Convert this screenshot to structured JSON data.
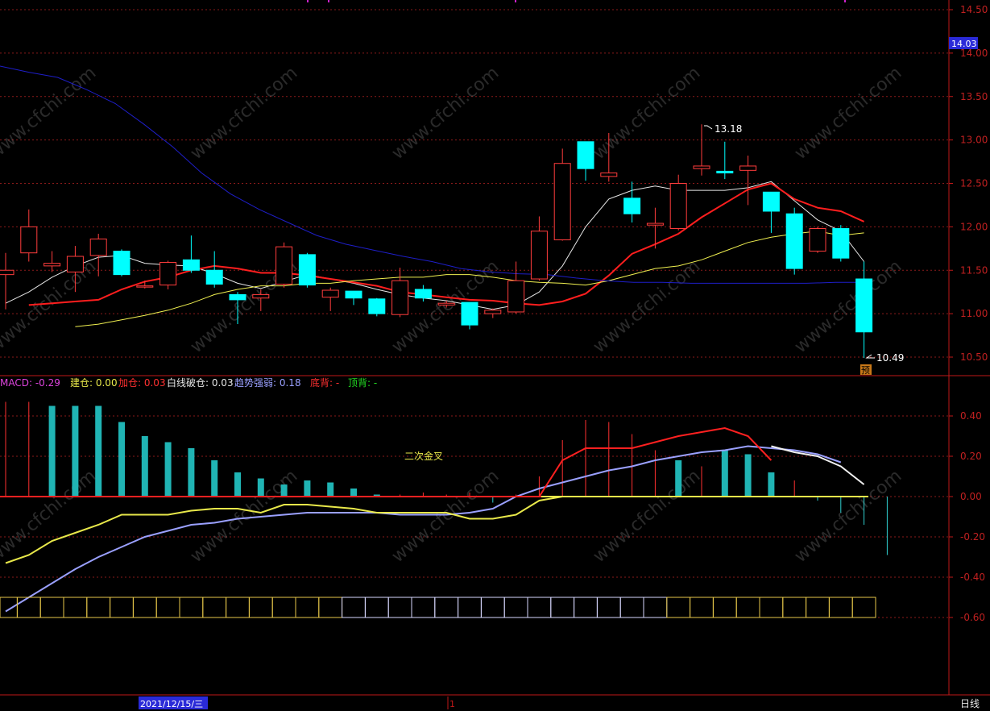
{
  "chart_data": [
    {
      "type": "candlestick",
      "title": "",
      "period_label": "日线",
      "date_label": "2021/12/15/三",
      "cursor_label": "1",
      "ylim": [
        10.25,
        14.6
      ],
      "yticks": [
        "14.50",
        "14.00",
        "13.50",
        "13.00",
        "12.50",
        "12.00",
        "11.50",
        "11.00",
        "10.50"
      ],
      "current_price_tag": "14.03",
      "high_annotation": "13.18",
      "low_annotation": "10.49",
      "forecast_badge": "预",
      "candles": [
        {
          "o": 11.45,
          "h": 11.7,
          "l": 11.05,
          "c": 11.5
        },
        {
          "o": 11.7,
          "h": 12.2,
          "l": 11.6,
          "c": 12.0
        },
        {
          "o": 11.55,
          "h": 11.72,
          "l": 11.48,
          "c": 11.58
        },
        {
          "o": 11.48,
          "h": 11.78,
          "l": 11.25,
          "c": 11.66
        },
        {
          "o": 11.67,
          "h": 11.92,
          "l": 11.43,
          "c": 11.86
        },
        {
          "o": 11.72,
          "h": 11.74,
          "l": 11.43,
          "c": 11.45
        },
        {
          "o": 11.31,
          "h": 11.38,
          "l": 11.29,
          "c": 11.32
        },
        {
          "o": 11.33,
          "h": 11.61,
          "l": 11.28,
          "c": 11.59
        },
        {
          "o": 11.62,
          "h": 11.9,
          "l": 11.47,
          "c": 11.5
        },
        {
          "o": 11.5,
          "h": 11.72,
          "l": 11.3,
          "c": 11.34
        },
        {
          "o": 11.22,
          "h": 11.25,
          "l": 10.88,
          "c": 11.16
        },
        {
          "o": 11.18,
          "h": 11.28,
          "l": 11.03,
          "c": 11.22
        },
        {
          "o": 11.34,
          "h": 11.82,
          "l": 11.3,
          "c": 11.77
        },
        {
          "o": 11.68,
          "h": 11.7,
          "l": 11.3,
          "c": 11.33
        },
        {
          "o": 11.19,
          "h": 11.3,
          "l": 11.03,
          "c": 11.27
        },
        {
          "o": 11.26,
          "h": 11.26,
          "l": 11.1,
          "c": 11.18
        },
        {
          "o": 11.17,
          "h": 11.18,
          "l": 10.97,
          "c": 11.0
        },
        {
          "o": 10.99,
          "h": 11.53,
          "l": 10.96,
          "c": 11.38
        },
        {
          "o": 11.28,
          "h": 11.33,
          "l": 11.14,
          "c": 11.18
        },
        {
          "o": 11.1,
          "h": 11.15,
          "l": 11.07,
          "c": 11.12
        },
        {
          "o": 11.13,
          "h": 11.13,
          "l": 10.82,
          "c": 10.87
        },
        {
          "o": 11.0,
          "h": 11.06,
          "l": 10.95,
          "c": 11.04
        },
        {
          "o": 11.02,
          "h": 11.6,
          "l": 11.0,
          "c": 11.38
        },
        {
          "o": 11.4,
          "h": 12.12,
          "l": 11.38,
          "c": 11.95
        },
        {
          "o": 11.85,
          "h": 12.9,
          "l": 11.84,
          "c": 12.73
        },
        {
          "o": 12.98,
          "h": 12.98,
          "l": 12.53,
          "c": 12.67
        },
        {
          "o": 12.58,
          "h": 13.08,
          "l": 12.52,
          "c": 12.62
        },
        {
          "o": 12.33,
          "h": 12.52,
          "l": 12.05,
          "c": 12.15
        },
        {
          "o": 12.02,
          "h": 12.22,
          "l": 11.75,
          "c": 12.04
        },
        {
          "o": 11.98,
          "h": 12.6,
          "l": 11.96,
          "c": 12.5
        },
        {
          "o": 12.67,
          "h": 13.18,
          "l": 12.59,
          "c": 12.7
        },
        {
          "o": 12.64,
          "h": 12.98,
          "l": 12.55,
          "c": 12.62
        },
        {
          "o": 12.65,
          "h": 12.82,
          "l": 12.25,
          "c": 12.7
        },
        {
          "o": 12.4,
          "h": 12.4,
          "l": 11.93,
          "c": 12.18
        },
        {
          "o": 12.15,
          "h": 12.22,
          "l": 11.45,
          "c": 11.52
        },
        {
          "o": 11.72,
          "h": 12.0,
          "l": 11.7,
          "c": 11.98
        },
        {
          "o": 11.98,
          "h": 12.02,
          "l": 11.6,
          "c": 11.64
        },
        {
          "o": 11.4,
          "h": 11.6,
          "l": 10.49,
          "c": 10.79
        }
      ],
      "series": [
        {
          "color": "#e6e6e6",
          "values": [
            11.12,
            11.25,
            11.42,
            11.55,
            11.65,
            11.67,
            11.58,
            11.56,
            11.55,
            11.46,
            11.35,
            11.29,
            11.37,
            11.45,
            11.4,
            11.35,
            11.28,
            11.22,
            11.18,
            11.15,
            11.1,
            11.05,
            11.1,
            11.25,
            11.55,
            12.0,
            12.32,
            12.42,
            12.47,
            12.42,
            12.42,
            12.42,
            12.45,
            12.52,
            12.3,
            12.08,
            11.95,
            11.6
          ]
        },
        {
          "color": "#ff1e1e",
          "values": [
            11.1,
            11.12,
            11.14,
            11.16,
            11.28,
            11.37,
            11.42,
            11.5,
            11.55,
            11.52,
            11.47,
            11.47,
            11.44,
            11.4,
            11.36,
            11.32,
            11.25,
            11.22,
            11.19,
            11.16,
            11.15,
            11.12,
            11.1,
            11.14,
            11.23,
            11.44,
            11.69,
            11.8,
            11.92,
            12.11,
            12.27,
            12.43,
            12.5,
            12.32,
            12.22,
            12.18,
            12.06
          ]
        },
        {
          "color": "#f0f050",
          "values": [
            10.85,
            10.88,
            10.93,
            10.98,
            11.04,
            11.12,
            11.22,
            11.28,
            11.32,
            11.32,
            11.35,
            11.35,
            11.38,
            11.4,
            11.42,
            11.42,
            11.45,
            11.45,
            11.42,
            11.38,
            11.36,
            11.35,
            11.33,
            11.38,
            11.45,
            11.52,
            11.55,
            11.62,
            11.72,
            11.82,
            11.88,
            11.92,
            11.95,
            11.9,
            11.93
          ]
        },
        {
          "color": "#1e1ec8",
          "values": [
            13.85,
            13.78,
            13.72,
            13.58,
            13.42,
            13.18,
            12.92,
            12.62,
            12.38,
            12.2,
            12.05,
            11.9,
            11.8,
            11.73,
            11.66,
            11.6,
            11.52,
            11.48,
            11.46,
            11.45,
            11.41,
            11.38,
            11.36,
            11.36,
            11.35,
            11.35,
            11.35,
            11.35,
            11.35,
            11.36,
            11.36
          ]
        }
      ]
    },
    {
      "type": "macd",
      "ylim": [
        -0.7,
        0.56
      ],
      "yticks": [
        "0.40",
        "0.20",
        "0.00",
        "-0.20",
        "-0.40",
        "-0.60"
      ],
      "legend": [
        {
          "text": "MACD: -0.29",
          "color": "#dd44dd"
        },
        {
          "text": "建仓: 0.00",
          "color": "#e8e84a"
        },
        {
          "text": "加仓: 0.03",
          "color": "#ff3030"
        },
        {
          "text": "白线破仓: 0.03",
          "color": "#e6e6e6"
        },
        {
          "text": "趋势强弱: 0.18",
          "color": "#9aa0ff"
        },
        {
          "text": "底背: -",
          "color": "#ff3030"
        },
        {
          "text": "顶背: -",
          "color": "#22dd22"
        }
      ],
      "annotation": "二次金叉",
      "histogram": [
        0.47,
        0.47,
        0.45,
        0.45,
        0.45,
        0.37,
        0.3,
        0.27,
        0.24,
        0.18,
        0.12,
        0.09,
        0.06,
        0.08,
        0.07,
        0.04,
        0.01,
        0.01,
        0.02,
        0.01,
        0.02,
        -0.03,
        0.01,
        0.1,
        0.28,
        0.38,
        0.37,
        0.31,
        0.23,
        0.18,
        0.15,
        0.23,
        0.21,
        0.12,
        0.08,
        -0.02,
        -0.08,
        -0.14,
        -0.29
      ],
      "line_white_yellow": [
        -0.33,
        -0.29,
        -0.22,
        -0.18,
        -0.14,
        -0.09,
        -0.09,
        -0.09,
        -0.07,
        -0.06,
        -0.06,
        -0.08,
        -0.04,
        -0.04,
        -0.05,
        -0.06,
        -0.08,
        -0.08,
        -0.08,
        -0.08,
        -0.11,
        -0.11,
        -0.09,
        -0.02,
        0.0,
        0.0,
        0.0,
        0.0,
        0.0,
        0.0,
        0.0,
        0.0,
        0.0,
        0.0,
        0.0,
        0.0,
        0.0,
        0.0
      ],
      "line_red": [
        0.0,
        0.0,
        0.0,
        0.0,
        0.0,
        0.0,
        0.0,
        0.0,
        0.0,
        0.0,
        0.0,
        0.0,
        0.0,
        0.0,
        0.0,
        0.0,
        0.0,
        0.0,
        0.0,
        0.0,
        0.0,
        0.0,
        0.0,
        0.0,
        0.18,
        0.24,
        0.24,
        0.24,
        0.27,
        0.3,
        0.32,
        0.34,
        0.3,
        0.18
      ],
      "line_white_tail": [
        0.25,
        0.22,
        0.2,
        0.15,
        0.06
      ],
      "line_purple": [
        -0.57,
        -0.5,
        -0.43,
        -0.36,
        -0.3,
        -0.25,
        -0.2,
        -0.17,
        -0.14,
        -0.13,
        -0.11,
        -0.1,
        -0.09,
        -0.08,
        -0.08,
        -0.08,
        -0.08,
        -0.09,
        -0.09,
        -0.09,
        -0.08,
        -0.06,
        0.0,
        0.04,
        0.07,
        0.1,
        0.13,
        0.15,
        0.18,
        0.2,
        0.22,
        0.23,
        0.25,
        0.24,
        0.23,
        0.21,
        0.17
      ],
      "band": [
        "y",
        "y",
        "y",
        "y",
        "y",
        "y",
        "y",
        "y",
        "y",
        "y",
        "y",
        "y",
        "y",
        "y",
        "y",
        "w",
        "w",
        "w",
        "w",
        "w",
        "w",
        "w",
        "w",
        "w",
        "w",
        "w",
        "w",
        "w",
        "w",
        "y",
        "y",
        "y",
        "y",
        "y",
        "y",
        "y",
        "y",
        "y"
      ]
    }
  ],
  "watermark": "www.cfchi.com",
  "colors": {
    "up": "#ff3c3c",
    "down": "#00ffff",
    "grid": "#8a1a1a",
    "axis": "#c01818",
    "tag_bg": "#2a2ad8"
  }
}
